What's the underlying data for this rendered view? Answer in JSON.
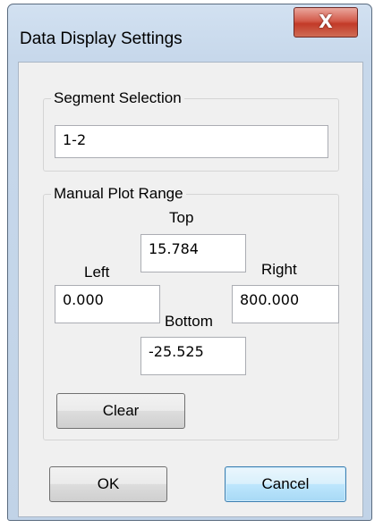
{
  "window": {
    "title": "Data Display Settings",
    "close_glyph": "X"
  },
  "segment_selection": {
    "label": "Segment Selection",
    "value": "1-2"
  },
  "manual_plot_range": {
    "label": "Manual Plot Range",
    "top": {
      "label": "Top",
      "value": "15.784"
    },
    "left": {
      "label": "Left",
      "value": "0.000"
    },
    "right": {
      "label": "Right",
      "value": "800.000"
    },
    "bottom": {
      "label": "Bottom",
      "value": "-25.525"
    },
    "clear_label": "Clear"
  },
  "buttons": {
    "ok_label": "OK",
    "cancel_label": "Cancel"
  },
  "colors": {
    "title_bar": "#c7d8eb",
    "close_button": "#c94a36",
    "focused_button_border": "#3c7fb1"
  }
}
